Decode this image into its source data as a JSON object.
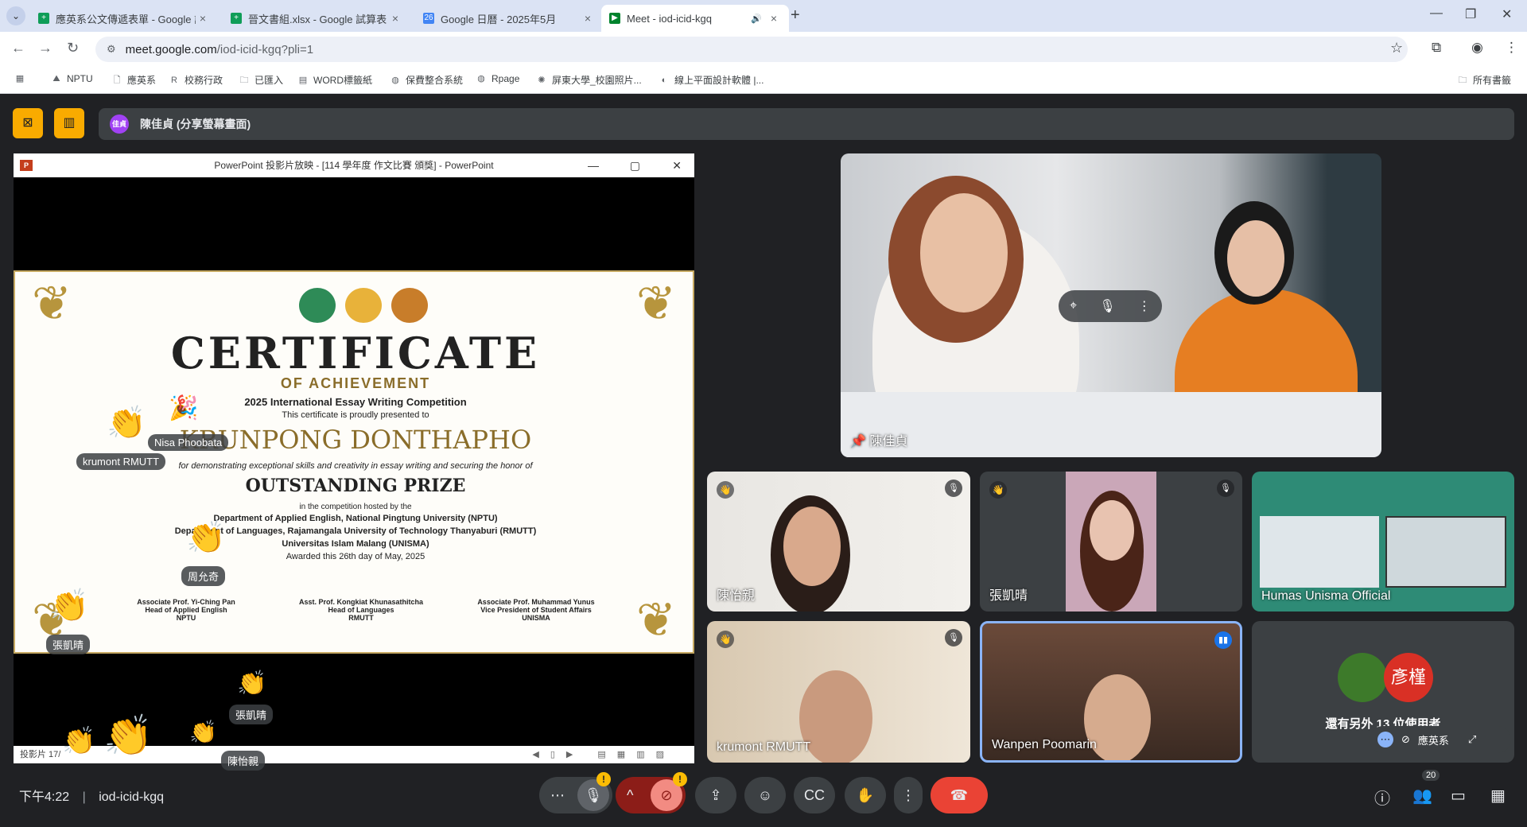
{
  "browser": {
    "tabs": [
      {
        "title": "應英系公文傳遞表單 - Google 試...",
        "favicon": "sheets-icon",
        "color": "#0f9d58"
      },
      {
        "title": "晉文書組.xlsx - Google 試算表",
        "favicon": "sheets-icon",
        "color": "#0f9d58"
      },
      {
        "title": "Google 日曆 - 2025年5月",
        "favicon": "calendar-icon",
        "color": "#4285f4"
      },
      {
        "title": "Meet - iod-icid-kgq",
        "favicon": "meet-icon",
        "color": "#00832d"
      }
    ],
    "url_host": "meet.google.com",
    "url_path": "/iod-icid-kgq?pli=1",
    "bookmarks": [
      "NPTU",
      "應英系",
      "校務行政",
      "已匯入",
      "WORD標籤紙",
      "保費整合系統",
      "Rpage",
      "屏東大學_校園照片...",
      "線上平面設計軟體 |..."
    ],
    "all_bookmarks": "所有書籤"
  },
  "meet": {
    "presenter_label": "陳佳貞 (分享螢幕畫面)",
    "presenter_avatar": "佳貞",
    "ppt_window_title": "PowerPoint 投影片放映 - [114 學年度 作文比賽 頒獎] - PowerPoint",
    "ppt_status": "投影片 17/",
    "certificate": {
      "title": "CERTIFICATE",
      "subtitle": "OF ACHIEVEMENT",
      "competition": "2025 International Essay Writing Competition",
      "presented": "This certificate is proudly presented to",
      "recipient": "KRUNPONG DONTHAPHO",
      "for_line": "for demonstrating exceptional skills and creativity in essay writing and securing the honor of",
      "prize": "OUTSTANDING PRIZE",
      "hosted": "in the competition hosted by the",
      "host1": "Department of Applied English, National Pingtung University (NPTU)",
      "host2": "Department of Languages, Rajamangala University of Technology Thanyaburi (RMUTT)",
      "host3": "Universitas Islam Malang (UNISMA)",
      "awarded": "Awarded this 26th day of May, 2025",
      "signers": [
        {
          "name": "Associate Prof. Yi-Ching Pan",
          "role": "Head of Applied English",
          "org": "NPTU"
        },
        {
          "name": "Asst. Prof. Kongkiat Khunasathitcha",
          "role": "Head of Languages",
          "org": "RMUTT"
        },
        {
          "name": "Associate Prof. Muhammad Yunus",
          "role": "Vice President of Student Affairs",
          "org": "UNISMA"
        }
      ]
    },
    "reactions": [
      "krumont RMUTT",
      "Nisa Phoobata",
      "周允奇",
      "張凱晴",
      "張凱晴",
      "陳怡親"
    ],
    "main_speaker": "陳佳貞",
    "tiles": [
      "陳怡親",
      "張凱晴",
      "Humas Unisma Official",
      "krumont RMUTT",
      "Wanpen Poomarin"
    ],
    "others_text": "還有另外 13 位使用者",
    "others_avatar": "彥槿",
    "others_self": "應英系",
    "time": "下午4:22",
    "meeting_code": "iod-icid-kgq",
    "participants_count": "20",
    "colors": {
      "hangup": "#ea4335",
      "warning": "#fbbc04",
      "muted": "#8c1d18",
      "accent": "#f9ab00"
    }
  }
}
